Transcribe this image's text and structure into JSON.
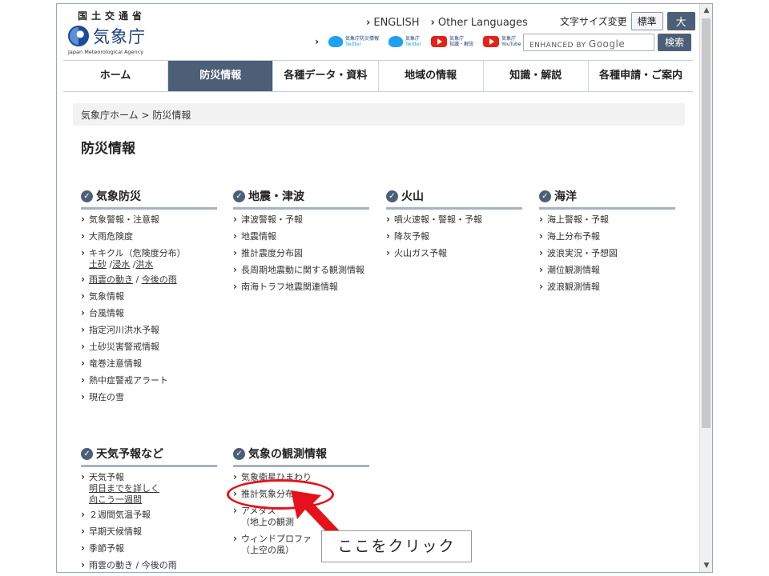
{
  "header": {
    "ministry": "国土交通省",
    "agency_jp": "気象庁",
    "agency_en": "Japan Meteorological Agency",
    "lang_english": "ENGLISH",
    "lang_other": "Other Languages",
    "font_size_label": "文字サイズ変更",
    "font_std": "標準",
    "font_large": "大",
    "sns": [
      {
        "line1": "気象庁防災情報",
        "line2": "Twitter",
        "icon": "twitter-icon"
      },
      {
        "line1": "気象庁",
        "line2": "Twitter",
        "icon": "twitter-icon"
      },
      {
        "line1": "気象庁",
        "line2": "知識・解説",
        "icon": "youtube-icon"
      },
      {
        "line1": "気象庁",
        "line2": "YouTube",
        "icon": "youtube-icon"
      }
    ],
    "search_enhanced": "ENHANCED BY",
    "search_google": "Google",
    "search_button": "検索"
  },
  "nav": [
    {
      "label": "ホーム"
    },
    {
      "label": "防災情報"
    },
    {
      "label": "各種データ・資料"
    },
    {
      "label": "地域の情報"
    },
    {
      "label": "知識・解説"
    },
    {
      "label": "各種申請・ご案内"
    }
  ],
  "breadcrumb": "気象庁ホーム > 防災情報",
  "page_title": "防災情報",
  "sections": {
    "kisho_bosai": {
      "title": "気象防災",
      "items": [
        "気象警報・注意報",
        "大雨危険度",
        "キキクル（危険度分布）",
        "雨雲の動き",
        "今後の雨",
        "気象情報",
        "台風情報",
        "指定河川洪水予報",
        "土砂災害警戒情報",
        "竜巻注意情報",
        "熱中症警戒アラート",
        "現在の雪"
      ],
      "kikikuru_sub": [
        "土砂",
        "浸水",
        "洪水"
      ]
    },
    "jishin": {
      "title": "地震・津波",
      "items": [
        "津波警報・予報",
        "地震情報",
        "推計震度分布図",
        "長周期地震動に関する観測情報",
        "南海トラフ地震関連情報"
      ]
    },
    "kazan": {
      "title": "火山",
      "items": [
        "噴火速報・警報・予報",
        "降灰予報",
        "火山ガス予報"
      ]
    },
    "kaiyo": {
      "title": "海洋",
      "items": [
        "海上警報・予報",
        "海上分布予報",
        "波浪実況・予想図",
        "潮位観測情報",
        "波浪観測情報"
      ]
    },
    "tenki": {
      "title": "天気予報など",
      "items": [
        "天気予報",
        "明日までを詳しく",
        "向こう一週間",
        "２週間気温予報",
        "早期天候情報",
        "季節予報",
        "雨雲の動き / 今後の雨"
      ]
    },
    "kansoku": {
      "title": "気象の観測情報",
      "items": [
        "気象衛星ひまわり",
        "推計気象分布",
        "アメダス",
        "（地上の観測",
        "ウィンドプロファ",
        "（上空の風）"
      ]
    }
  },
  "annotation": {
    "label": "ここをクリック",
    "color": "#e5121b"
  }
}
